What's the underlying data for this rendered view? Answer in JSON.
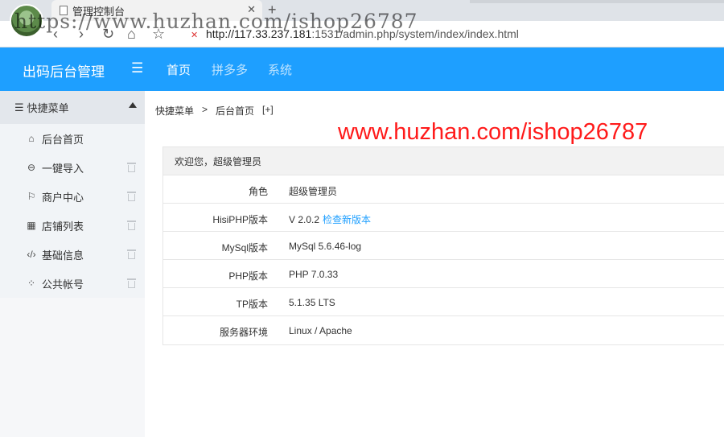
{
  "browser": {
    "tab_title": "管理控制台",
    "url_host": "http://117.33.237.181",
    "url_rest": ":1531/admin.php/system/index/index.html",
    "watermark": "https://www.huzhan.com/ishop26787"
  },
  "header": {
    "logo": "出码后台管理",
    "nav": [
      "首页",
      "拼多多",
      "系统"
    ]
  },
  "sidebar": {
    "title": "快捷菜单",
    "items": [
      {
        "label": "后台首页"
      },
      {
        "label": "一键导入"
      },
      {
        "label": "商户中心"
      },
      {
        "label": "店铺列表"
      },
      {
        "label": "基础信息"
      },
      {
        "label": "公共帐号"
      }
    ]
  },
  "breadcrumb": [
    "快捷菜单",
    ">",
    "后台首页",
    "[+]"
  ],
  "overlay_watermark": "www.huzhan.com/ishop26787",
  "panel": {
    "title": "欢迎您，超级管理员",
    "rows": [
      {
        "key": "角色",
        "value": "超级管理员"
      },
      {
        "key": "HisiPHP版本",
        "value": "V 2.0.2",
        "link": "检查新版本"
      },
      {
        "key": "MySql版本",
        "value": "MySql 5.6.46-log"
      },
      {
        "key": "PHP版本",
        "value": "PHP 7.0.33"
      },
      {
        "key": "TP版本",
        "value": "5.1.35 LTS"
      },
      {
        "key": "服务器环境",
        "value": "Linux / Apache"
      }
    ]
  },
  "colors": {
    "primary": "#1e9fff",
    "watermark_red": "#ff1a1a"
  }
}
